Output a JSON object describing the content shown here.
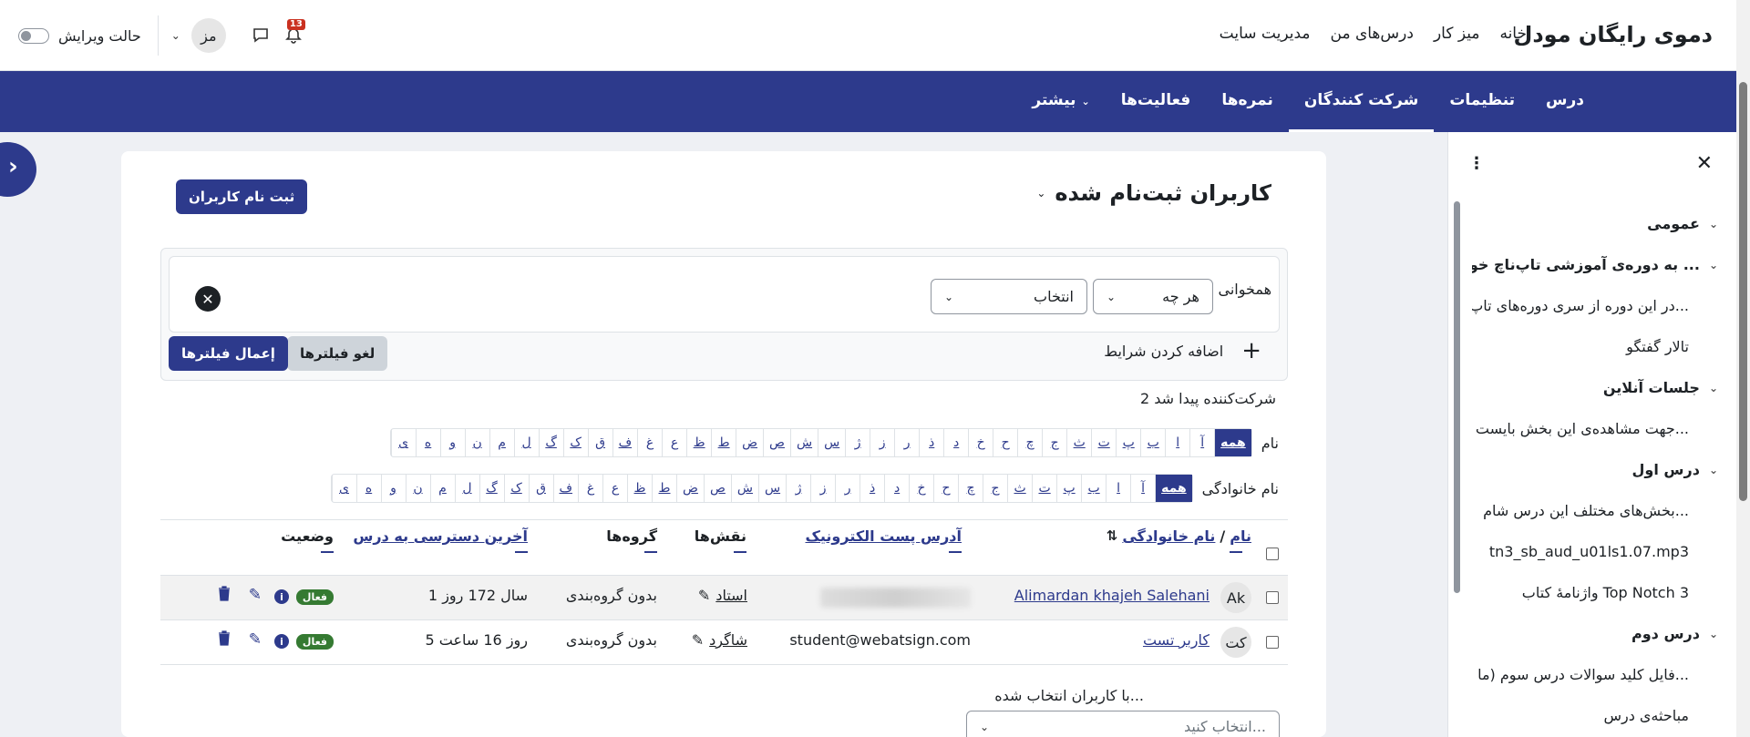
{
  "topbar": {
    "site_name": "دموی رایگان مودل",
    "nav": [
      "خانه",
      "میز کار",
      "درس‌های من",
      "مدیریت سایت"
    ],
    "notification_count": "13",
    "user_initials": "مز",
    "edit_mode_label": "حالت ویرایش"
  },
  "secondary_nav": {
    "items": [
      "درس",
      "تنظیمات",
      "شرکت کنندگان",
      "نمره‌ها",
      "فعالیت‌ها",
      "بیشتر"
    ],
    "active": "شرکت کنندگان"
  },
  "course_index": {
    "items": [
      {
        "label": "عمومی",
        "type": "section"
      },
      {
        "label": "به دوره‌ی آموزشی تاپ‌ناچ خوش ...",
        "type": "section"
      },
      {
        "label": "در این دوره از سری دوره‌های تاپ...",
        "type": "item"
      },
      {
        "label": "تالار گفتگو",
        "type": "item"
      },
      {
        "label": "جلسات آنلاین",
        "type": "section"
      },
      {
        "label": "جهت مشاهده‌ی این بخش بایست...",
        "type": "item"
      },
      {
        "label": "درس اول",
        "type": "section"
      },
      {
        "label": "بخش‌های مختلف این درس شام...",
        "type": "item"
      },
      {
        "label": "tn3_sb_aud_u01ls1.07.mp3",
        "type": "item"
      },
      {
        "label": "واژنامهٔ کتاب Top Notch 3",
        "type": "item"
      },
      {
        "label": "درس دوم",
        "type": "section"
      },
      {
        "label": "فایل کلید سوالات درس سوم (ما...",
        "type": "item"
      },
      {
        "label": "مباحثه‌ی درس",
        "type": "item"
      }
    ]
  },
  "page": {
    "title": "کاربران ثبت‌نام شده",
    "enrol_button": "ثبت نام کاربران"
  },
  "filters": {
    "match_label": "همخوانی",
    "match_value": "هر چه",
    "select_placeholder": "انتخاب",
    "add_condition": "اضافه کردن شرایط",
    "clear_button": "لغو فیلترها",
    "apply_button": "إعمال فیلترها"
  },
  "found_text": "2 شرکت‌کننده پیدا شد",
  "initials_first": {
    "label": "نام",
    "all": "همه",
    "letters": [
      "آ",
      "ا",
      "ب",
      "پ",
      "ت",
      "ث",
      "ج",
      "چ",
      "ح",
      "خ",
      "د",
      "ذ",
      "ر",
      "ز",
      "ژ",
      "س",
      "ش",
      "ص",
      "ض",
      "ط",
      "ظ",
      "ع",
      "غ",
      "ف",
      "ق",
      "ک",
      "گ",
      "ل",
      "م",
      "ن",
      "و",
      "ه",
      "ی"
    ]
  },
  "initials_last": {
    "label": "نام خانوادگی",
    "all": "همه",
    "letters": [
      "آ",
      "ا",
      "ب",
      "پ",
      "ت",
      "ث",
      "ج",
      "چ",
      "ح",
      "خ",
      "د",
      "ذ",
      "ر",
      "ز",
      "ژ",
      "س",
      "ش",
      "ص",
      "ض",
      "ط",
      "ظ",
      "ع",
      "غ",
      "ف",
      "ق",
      "ک",
      "گ",
      "ل",
      "م",
      "ن",
      "و",
      "ه",
      "ی"
    ]
  },
  "table": {
    "headers": {
      "first_name": "نام",
      "separator": "/",
      "last_name": "نام خانوادگی",
      "email": "آدرس پست الکترونیک",
      "roles": "نقش‌ها",
      "groups": "گروه‌ها",
      "last_access": "آخرین دسترسی به درس",
      "status": "وضعیت"
    },
    "rows": [
      {
        "initials": "Ak",
        "name": "Alimardan khajeh Salehani",
        "email": "",
        "role": "استاد",
        "groups": "بدون گروه‌بندی",
        "last_access": "1 سال 172 روز",
        "status": "فعال"
      },
      {
        "initials": "کت",
        "name": "کاربر تست",
        "email": "student@webatsign.com",
        "role": "شاگرد",
        "groups": "بدون گروه‌بندی",
        "last_access": "5 روز 16 ساعت",
        "status": "فعال"
      }
    ]
  },
  "bulk": {
    "label": "با کاربران انتخاب شده...",
    "placeholder": "انتخاب کنید..."
  },
  "colors": {
    "primary": "#2d3a8c",
    "active_badge": "#357a32",
    "notification": "#ca3120"
  }
}
